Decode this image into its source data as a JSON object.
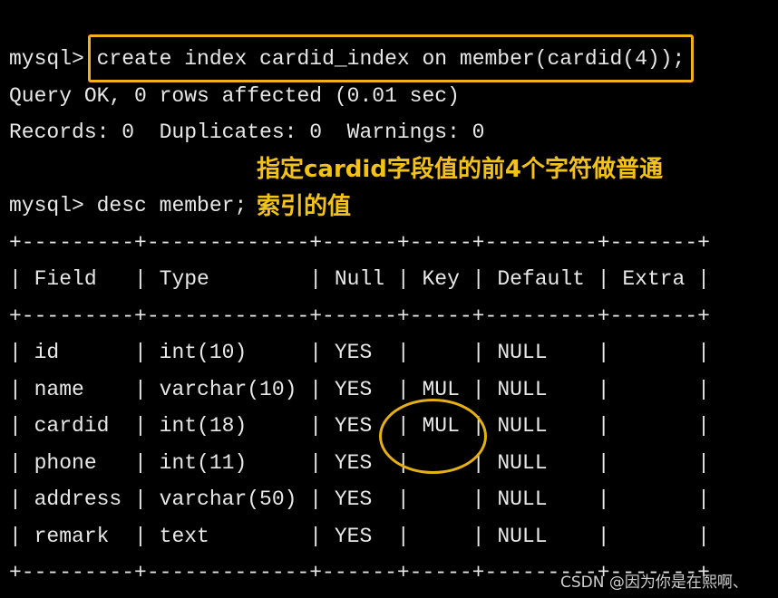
{
  "terminal": {
    "prompt": "mysql> ",
    "command1": "create index cardid_index on member(cardid(4));",
    "output1": "Query OK, 0 rows affected (0.01 sec)",
    "output2": "Records: 0  Duplicates: 0  Warnings: 0",
    "command2": "desc member;"
  },
  "annotation": {
    "line1": "指定cardid字段值的前4个字符做普通",
    "line2": "索引的值",
    "color": "#f2c21a"
  },
  "table": {
    "border": "+---------+-------------+------+-----+---------+-------+",
    "headers": [
      "Field",
      "Type",
      "Null",
      "Key",
      "Default",
      "Extra"
    ],
    "rows": [
      [
        "id",
        "int(10)",
        "YES",
        "",
        "NULL",
        ""
      ],
      [
        "name",
        "varchar(10)",
        "YES",
        "MUL",
        "NULL",
        ""
      ],
      [
        "cardid",
        "int(18)",
        "YES",
        "MUL",
        "NULL",
        ""
      ],
      [
        "phone",
        "int(11)",
        "YES",
        "",
        "NULL",
        ""
      ],
      [
        "address",
        "varchar(50)",
        "YES",
        "",
        "NULL",
        ""
      ],
      [
        "remark",
        "text",
        "YES",
        "",
        "NULL",
        ""
      ]
    ]
  },
  "watermark": "CSDN @因为你是在熙啊、"
}
